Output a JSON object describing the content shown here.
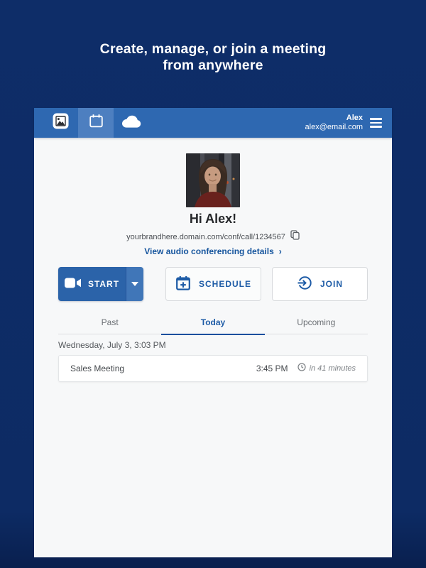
{
  "headline": {
    "line1": "Create, manage, or join a meeting",
    "line2": "from anywhere"
  },
  "header": {
    "user_name": "Alex",
    "user_email": "alex@email.com",
    "nav_icons": [
      "brand-image-icon",
      "calendar-icon",
      "cloud-icon"
    ],
    "selected_nav": "calendar-icon",
    "menu_icon": "hamburger-icon"
  },
  "profile": {
    "greeting": "Hi Alex!",
    "meeting_url": "yourbrandhere.domain.com/conf/call/1234567",
    "copy_icon": "copy-icon",
    "audio_details_label": "View audio conferencing details",
    "link_chevron": "›"
  },
  "actions": {
    "start_label": "START",
    "start_icon": "video-camera-icon",
    "start_caret_icon": "caret-down-icon",
    "schedule_label": "SCHEDULE",
    "schedule_icon": "calendar-plus-icon",
    "join_label": "JOIN",
    "join_icon": "enter-circle-icon"
  },
  "tabs": {
    "past": "Past",
    "today": "Today",
    "upcoming": "Upcoming",
    "active": "Today"
  },
  "meetings": {
    "date_header": "Wednesday, July 3, 3:03 PM",
    "items": [
      {
        "title": "Sales Meeting",
        "time": "3:45 PM",
        "countdown_icon": "clock-icon",
        "countdown": "in 41 minutes"
      }
    ]
  },
  "colors": {
    "background_navy": "#0d2b64",
    "header_blue": "#2e68b1",
    "header_selected_blue": "#4d7fc0",
    "primary_blue": "#1d5ba6",
    "start_button_blue": "#2b63a9",
    "start_dropdown_blue": "#4076b8",
    "link_blue": "#17569e",
    "content_background": "#f7f8f9",
    "active_tab_underline": "#1b4f9e"
  }
}
